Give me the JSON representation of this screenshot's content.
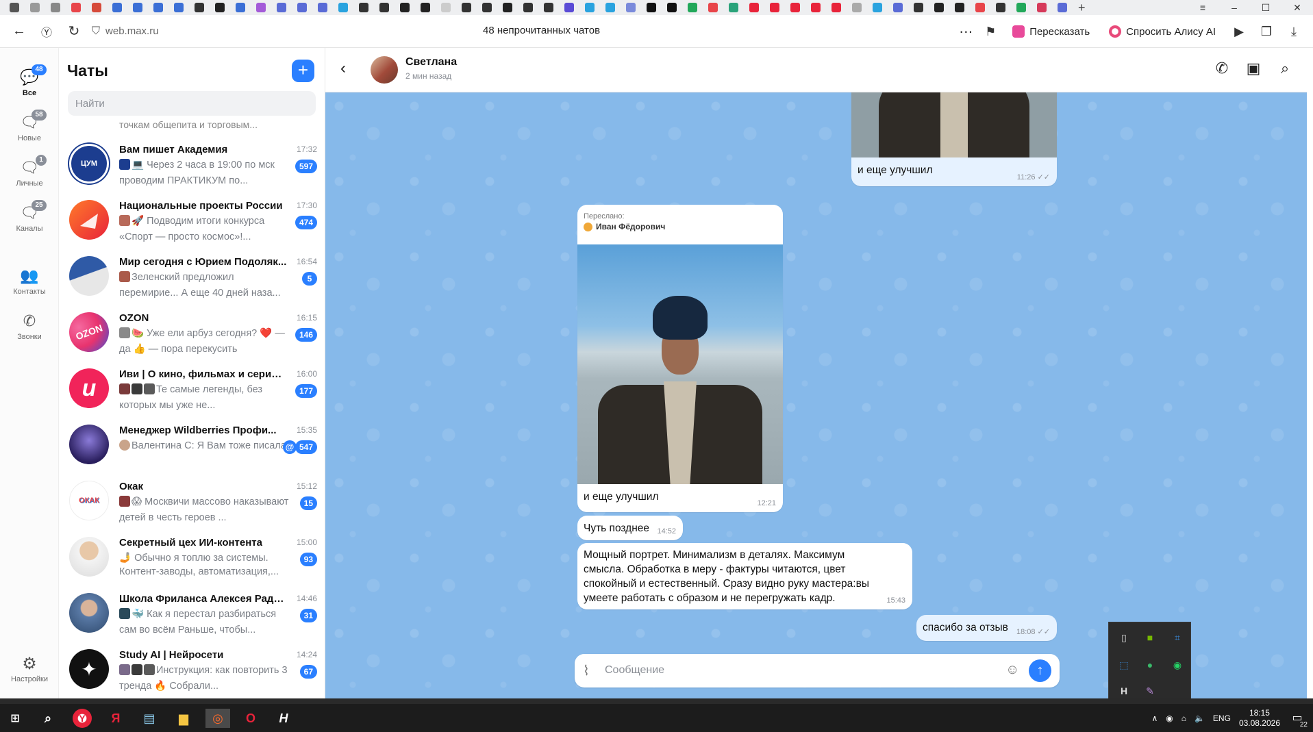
{
  "browser": {
    "url": "web.max.ru",
    "page_title": "48 непрочитанных чатов",
    "retell_label": "Пересказать",
    "ask_alice_label": "Спросить Алису AI",
    "accent_color": "#2a7fff"
  },
  "rail": {
    "items": [
      {
        "label": "Все",
        "badge": "48",
        "icon": "chat-bubble-icon"
      },
      {
        "label": "Новые",
        "badge": "58",
        "icon": "chat-new-icon"
      },
      {
        "label": "Личные",
        "badge": "1",
        "icon": "person-chat-icon"
      },
      {
        "label": "Каналы",
        "badge": "25",
        "icon": "channel-icon"
      },
      {
        "label": "Контакты",
        "badge": "",
        "icon": "contacts-icon"
      },
      {
        "label": "Звонки",
        "badge": "",
        "icon": "phone-icon"
      }
    ],
    "settings_label": "Настройки"
  },
  "chatlist": {
    "title": "Чаты",
    "search_placeholder": "Найти",
    "partial_preview": "точкам общепита и торговым...",
    "chats": [
      {
        "name": "Вам пишет Академия",
        "time": "17:32",
        "preview": "💻 Через 2 часа в 19:00 по мск проводим ПРАКТИКУМ по...",
        "badge": "597",
        "avatar_text": "ЦУМ",
        "avatar_color": "#1c3d8f"
      },
      {
        "name": "Национальные проекты России",
        "time": "17:30",
        "preview": "🚀 Подводим итоги конкурса «Спорт — просто космос»!...",
        "badge": "474",
        "avatar_text": "",
        "avatar_color": "#ee3b2f"
      },
      {
        "name": "Мир сегодня с Юрием Подоляк...",
        "time": "16:54",
        "preview": "Зеленский предложил перемирие... А еще 40 дней наза...",
        "badge": "5",
        "avatar_text": "",
        "avatar_color": "#2f5aa6"
      },
      {
        "name": "OZON",
        "time": "16:15",
        "preview": "🍉 Уже ели арбуз сегодня? ❤️ — да 👍 — пора перекусить",
        "badge": "146",
        "avatar_text": "OZON",
        "avatar_color": "#e8336e"
      },
      {
        "name": "Иви | О кино, фильмах и сериал...",
        "time": "16:00",
        "preview": "Те самые легенды, без которых мы уже не...",
        "badge": "177",
        "avatar_text": "и",
        "avatar_color": "#f1245a"
      },
      {
        "name": "Менеджер Wildberries Профи...",
        "time": "15:35",
        "preview": "Валентина С: Я Вам тоже писала",
        "badge": "547",
        "avatar_text": "",
        "avatar_color": "#3a2f6e",
        "mention": "@"
      },
      {
        "name": "Окак",
        "time": "15:12",
        "preview": "😱 Москвичи массово наказывают детей в честь героев ...",
        "badge": "15",
        "avatar_text": "ОКАК",
        "avatar_color": "#f4c542"
      },
      {
        "name": "Секретный цех ИИ-контента",
        "time": "15:00",
        "preview": "🤳 Обычно я топлю за системы. Контент-заводы, автоматизация,...",
        "badge": "93",
        "avatar_text": "",
        "avatar_color": "#8a7a6a"
      },
      {
        "name": "Школа Фриланса Алексея Радо...",
        "time": "14:46",
        "preview": "🐳 Как я перестал разбираться сам во всём Раньше, чтобы...",
        "badge": "31",
        "avatar_text": "",
        "avatar_color": "#3f5f86"
      },
      {
        "name": "Study AI | Нейросети",
        "time": "14:24",
        "preview": "Инструкция: как повторить 3 тренда 🔥 Собрали...",
        "badge": "67",
        "avatar_text": "✦",
        "avatar_color": "#111111"
      }
    ]
  },
  "conversation": {
    "contact_name": "Светлана",
    "status": "2 мин назад",
    "messages": [
      {
        "text": "и еще улучшил",
        "time": "11:26 ✓✓",
        "mine": true
      },
      {
        "forwarded_label": "Переслано:",
        "forwarded_from": "Иван Фёдорович",
        "text": "и еще улучшил",
        "time": "12:21",
        "mine": false
      },
      {
        "text": "Чуть позднее",
        "time": "14:52",
        "mine": false
      },
      {
        "text": "Мощный портрет. Минимализм в деталях. Максимум смысла. Обработка в меру - фактуры читаются, цвет спокойный и естественный. Сразу видно руку мастера:вы умеете работать с образом и не перегружать кадр.",
        "time": "15:43",
        "mine": false
      },
      {
        "text": "спасибо за отзыв",
        "time": "18:08 ✓✓",
        "mine": true
      }
    ],
    "composer_placeholder": "Сообщение"
  },
  "taskbar": {
    "lang": "ENG",
    "time": "18:15",
    "date": "03.08.2026",
    "notifications": "22"
  }
}
